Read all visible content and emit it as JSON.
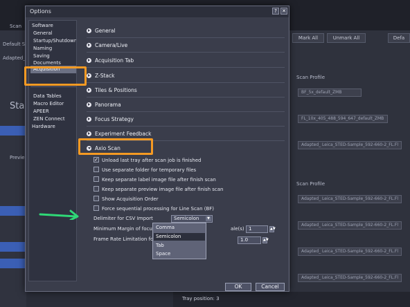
{
  "dialog": {
    "title": "Options",
    "help_icon": "?",
    "close_icon": "✕",
    "ok_label": "OK",
    "cancel_label": "Cancel"
  },
  "nav": {
    "software_header": "Software",
    "items": [
      "General",
      "Startup/Shutdown",
      "Naming",
      "Saving",
      "Documents",
      "Acquisition"
    ],
    "selected": "Acquisition",
    "items2": [
      "Data Tables",
      "Macro Editor",
      "APEER",
      "ZEN Connect"
    ],
    "hardware_header": "Hardware"
  },
  "sections": {
    "general": "General",
    "camera_live": "Camera/Live",
    "acquisition_tab": "Acquisition Tab",
    "z_stack": "Z-Stack",
    "tiles_positions": "Tiles & Positions",
    "panorama": "Panorama",
    "focus_strategy": "Focus Strategy",
    "experiment_feedback": "Experiment Feedback",
    "axio_scan": "Axio Scan"
  },
  "axio_options": [
    {
      "label": "Unload last tray after scan job is finished",
      "checked": true
    },
    {
      "label": "Use separate folder for temporary files",
      "checked": false
    },
    {
      "label": "Keep separate label image file after finish scan",
      "checked": false
    },
    {
      "label": "Keep separate preview image file after finish scan",
      "checked": false
    },
    {
      "label": "Show Acquisition Order",
      "checked": false
    },
    {
      "label": "Force sequential processing for Line Scan (BF)",
      "checked": false
    }
  ],
  "csv": {
    "label": "Delimiter for CSV Import",
    "value": "Semicolon",
    "options": [
      "Comma",
      "Semicolon",
      "Tab",
      "Space"
    ]
  },
  "margin": {
    "label": "Minimum Margin of focus",
    "label_tail": "ale(s)",
    "value": "1"
  },
  "framerate": {
    "label": "Frame Rate Limitation for",
    "value": "1.0"
  },
  "background": {
    "mark_all": "Mark All",
    "unmark_all": "Unmark All",
    "default_btn": "Defa",
    "scan_profile": "Scan Profile",
    "scan_profile2": "Scan Profile",
    "profile1": "BF_5x_default_ZMB",
    "profile2": "FL_10x_405_488_594_647_default_ZMB",
    "profile3": "Adapted_ Leica_STED-Sample_592-660-2_FL.Fl",
    "profile4": "Adapted_ Leica_STED-Sample_592-660-2_FL.Fl",
    "profile5": "Adapted_ Leica_STED-Sample_592-660-2_FL.Fl",
    "profile6": "Adapted_ Leica_STED-Sample_592-660-2_FL.Fl",
    "profile7": "Adapted_ Leica_STED-Sample_592-660-2_FL.Fl",
    "tray_position": "Tray position: 3",
    "left_scan": "Scan",
    "left_default": "Default S",
    "left_adapted": "Adapted_",
    "left_start": "Star",
    "left_preview": "Previe"
  }
}
